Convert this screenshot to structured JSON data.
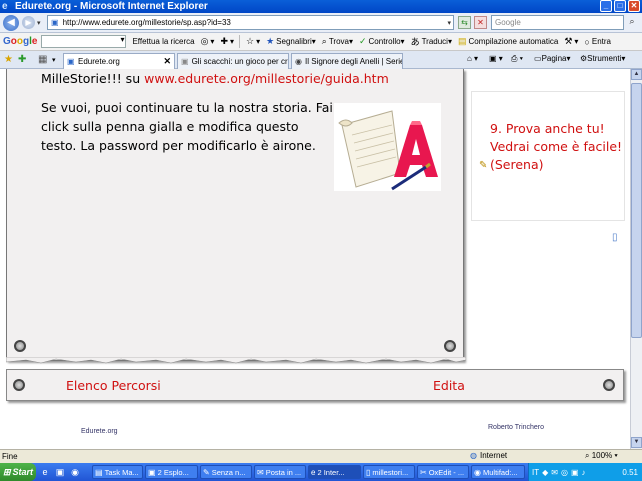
{
  "window": {
    "title": "Edurete.org - Microsoft Internet Explorer"
  },
  "address": {
    "url": "http://www.edurete.org/millestorie/sp.asp?id=33",
    "search_placeholder": "Google"
  },
  "google_toolbar": {
    "logo": "Google",
    "items": [
      "Effettua la ricerca",
      "Segnalibri",
      "Trova",
      "Controllo",
      "Traduci",
      "Compilazione automatica",
      "Entra"
    ]
  },
  "tabs": [
    {
      "label": "Edurete.org",
      "active": true
    },
    {
      "label": "Gli scacchi: un gioco per cres..."
    },
    {
      "label": "Il Signore degli Anelli | Serie ..."
    }
  ],
  "commandbar": {
    "page": "Pagina",
    "tools": "Strumenti"
  },
  "page": {
    "intro_prefix": "MilleStorie!!! su ",
    "intro_link": "www.edurete.org/millestorie/guida.htm",
    "story": "Se vuoi, puoi continuare tu la nostra storia. Fai click sulla penna gialla e modifica questo testo. La password per modificarlo è airone.",
    "side_text": "9. Prova anche tu! Vedrai come è facile! (Serena)",
    "nav_left": "Elenco Percorsi",
    "nav_right": "Edita",
    "footer_left": "Edurete.org",
    "footer_right": "Roberto Trinchero"
  },
  "status": {
    "text": "Fine",
    "zone": "Internet",
    "zoom": "100%"
  },
  "taskbar": {
    "start": "Start",
    "tasks": [
      "Task Ma...",
      "2 Esplo...",
      "Senza n...",
      "Posta in ...",
      "2 Inter...",
      "millestori...",
      "OxEdit - ...",
      "Multifad:..."
    ],
    "clock": "0.51"
  },
  "colors": {
    "link_red": "#d01010",
    "paper": "#f2f0f0",
    "xp_blue": "#2155d4"
  }
}
